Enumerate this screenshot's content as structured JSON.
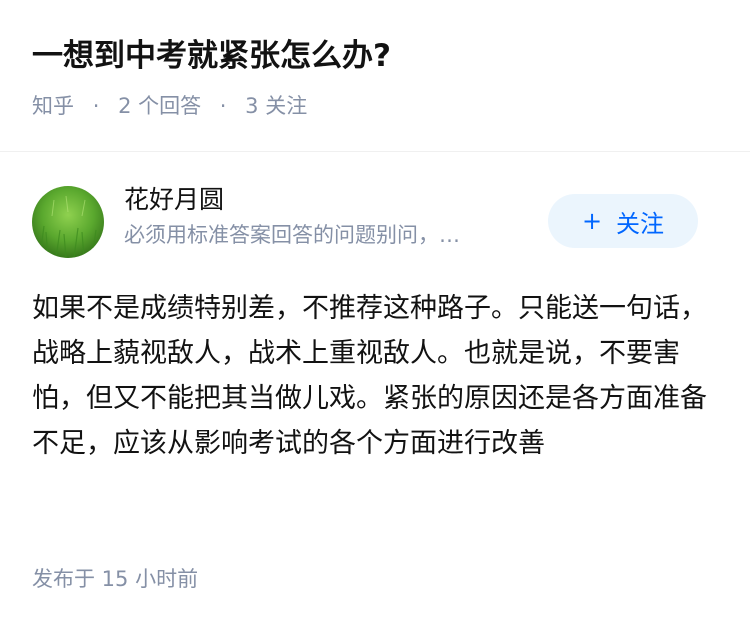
{
  "question": {
    "title": "一想到中考就紧张怎么办?",
    "source": "知乎",
    "separator": "·",
    "answer_count": "2 个回答",
    "follow_count": "3 关注"
  },
  "author": {
    "name": "花好月圆",
    "bio": "必须用标准答案回答的问题别问，…",
    "avatar": "grass-avatar",
    "follow_plus": "+",
    "follow_label": "关注"
  },
  "answer": {
    "content": "如果不是成绩特别差，不推荐这种路子。只能送一句话，战略上藐视敌人，战术上重视敌人。也就是说，不要害怕，但又不能把其当做儿戏。紧张的原因还是各方面准备不足，应该从影响考试的各个方面进行改善",
    "published": "发布于  15 小时前"
  },
  "colors": {
    "primary": "#0066ff",
    "button_bg": "#ebf5fd",
    "meta_text": "#8590a6",
    "body_text": "#121212"
  }
}
